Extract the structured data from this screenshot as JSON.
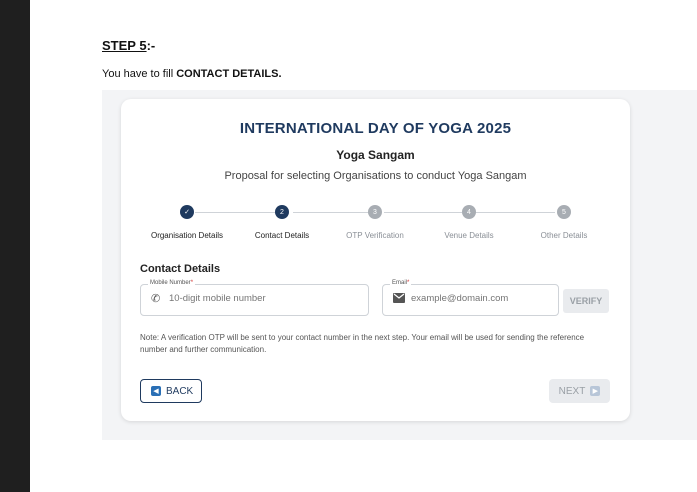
{
  "document": {
    "step_label": "STEP 5",
    "step_suffix": ":-",
    "instruction_prefix": "You have to fill ",
    "instruction_bold": "CONTACT DETAILS."
  },
  "form": {
    "title": "INTERNATIONAL DAY OF YOGA 2025",
    "subtitle": "Yoga Sangam",
    "tagline": "Proposal for selecting Organisations to conduct Yoga Sangam",
    "steps": [
      {
        "label": "Organisation Details",
        "number": "✓",
        "state": "done"
      },
      {
        "label": "Contact Details",
        "number": "2",
        "state": "active"
      },
      {
        "label": "OTP Verification",
        "number": "3",
        "state": "todo"
      },
      {
        "label": "Venue Details",
        "number": "4",
        "state": "todo"
      },
      {
        "label": "Other Details",
        "number": "5",
        "state": "todo"
      }
    ],
    "section_title": "Contact Details",
    "mobile": {
      "label": "Mobile Number",
      "required": "*",
      "placeholder": "10-digit mobile number",
      "icon": "phone-icon"
    },
    "email": {
      "label": "Email",
      "required": "*",
      "placeholder": "example@domain.com",
      "icon": "mail-icon"
    },
    "verify_label": "VERIFY",
    "note": "Note: A verification OTP will be sent to your contact number in the next step. Your email will be used for sending the reference number and further communication.",
    "back_label": "BACK",
    "next_label": "NEXT",
    "colors": {
      "primary": "#1f3a5f",
      "inactive": "#a8adb3",
      "required": "#d32f2f"
    }
  }
}
